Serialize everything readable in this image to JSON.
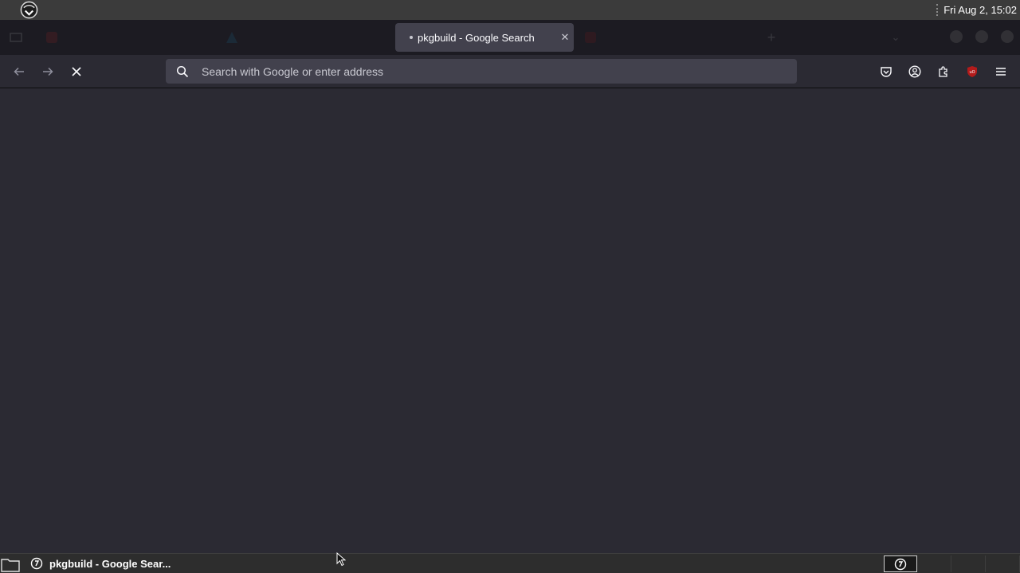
{
  "system_panel": {
    "logo_icon": "panel-logo-icon",
    "clock": "Fri Aug 2, 15:02"
  },
  "tabs": [
    {
      "title": "",
      "favicon_color": "#e22828",
      "state": "dim"
    },
    {
      "title": "",
      "favicon_color": "#1793d1",
      "state": "dim"
    },
    {
      "title": "pkgbuild - Google Search",
      "state": "active",
      "loading": true
    },
    {
      "title": "",
      "favicon_color": "#b31b1b",
      "state": "dim"
    }
  ],
  "navbar": {
    "back_icon": "arrow-left-icon",
    "forward_icon": "arrow-right-icon",
    "stop_icon": "close-icon",
    "address_placeholder": "Search with Google or enter address",
    "address_value": "",
    "toolbar_icons": [
      "pocket-icon",
      "account-icon",
      "extensions-icon",
      "ublock-icon",
      "menu-icon"
    ],
    "ublock_color": "#b31b1b"
  },
  "taskbar": {
    "task_title": "pkgbuild - Google Sear...",
    "workspaces": 4,
    "active_workspace": 1
  },
  "colors": {
    "frame": "#1c1b22",
    "toolbar": "#2b2a33",
    "field": "#42414d",
    "text": "#fbfbfe"
  }
}
